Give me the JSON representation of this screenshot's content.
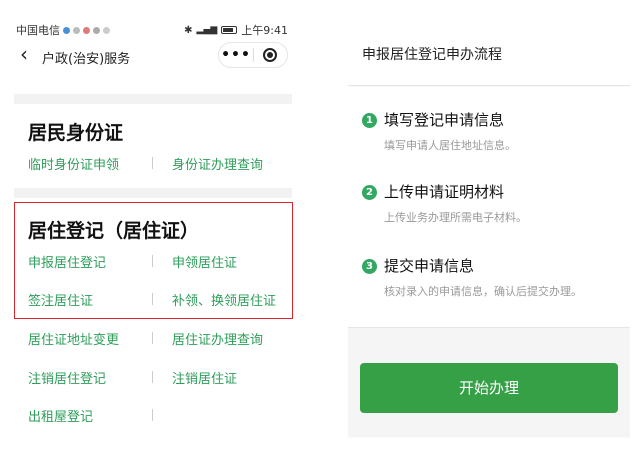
{
  "status_bar": {
    "carrier": "中国电信",
    "time": "上午9:41",
    "battery": "82"
  },
  "nav": {
    "title": "户政(治安)服务"
  },
  "sections": {
    "id_card": {
      "title": "居民身份证",
      "links": [
        "临时身份证申领",
        "身份证办理查询"
      ]
    },
    "residence": {
      "title": "居住登记（居住证）",
      "links": [
        "申报居住登记",
        "申领居住证",
        "签注居住证",
        "补领、换领居住证",
        "居住证地址变更",
        "居住证办理查询",
        "注销居住登记",
        "注销居住证",
        "出租屋登记"
      ]
    }
  },
  "process": {
    "title": "申报居住登记申办流程",
    "steps": [
      {
        "num": "1",
        "title": "填写登记申请信息",
        "desc": "填写申请人居住地址信息。"
      },
      {
        "num": "2",
        "title": "上传申请证明材料",
        "desc": "上传业务办理所需电子材料。"
      },
      {
        "num": "3",
        "title": "提交申请信息",
        "desc": "核对录入的申请信息，确认后提交办理。"
      }
    ],
    "start_button": "开始办理"
  },
  "colors": {
    "accent_green": "#2e9e5a",
    "button_green": "#35a046",
    "highlight_red": "#d9262c"
  }
}
